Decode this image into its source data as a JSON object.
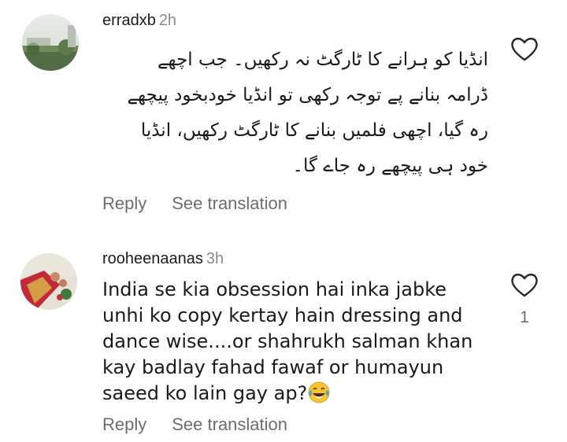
{
  "comments": [
    {
      "username": "erradxb",
      "time": "2h",
      "text": "انڈیا کو ہرانے کا ٹارگٹ نہ رکھیں۔ جب اچھے ڈرامہ بنانے پے توجہ رکھی تو انڈیا خودبخود پیچھے رہ گیا، اچھی فلمیں بنانے کا ٹارگٹ رکھیں، انڈیا خود ہی پیچھے رہ جاے گا۔",
      "reply_label": "Reply",
      "translate_label": "See translation"
    },
    {
      "username": "rooheenaanas",
      "time": "3h",
      "text": "India se kia obsession hai inka jabke unhi ko copy kertay hain dressing and dance wise....or shahrukh salman khan kay badlay fahad fawaf or humayun saeed ko lain gay ap?",
      "emoji": "face-with-tears-of-joy",
      "likes": "1",
      "reply_label": "Reply",
      "translate_label": "See translation"
    }
  ],
  "icons": {
    "like": "heart-outline-icon"
  },
  "colors": {
    "text": "#1a1a1a",
    "secondary": "#6d6d6d",
    "time": "#8a8a8a"
  }
}
